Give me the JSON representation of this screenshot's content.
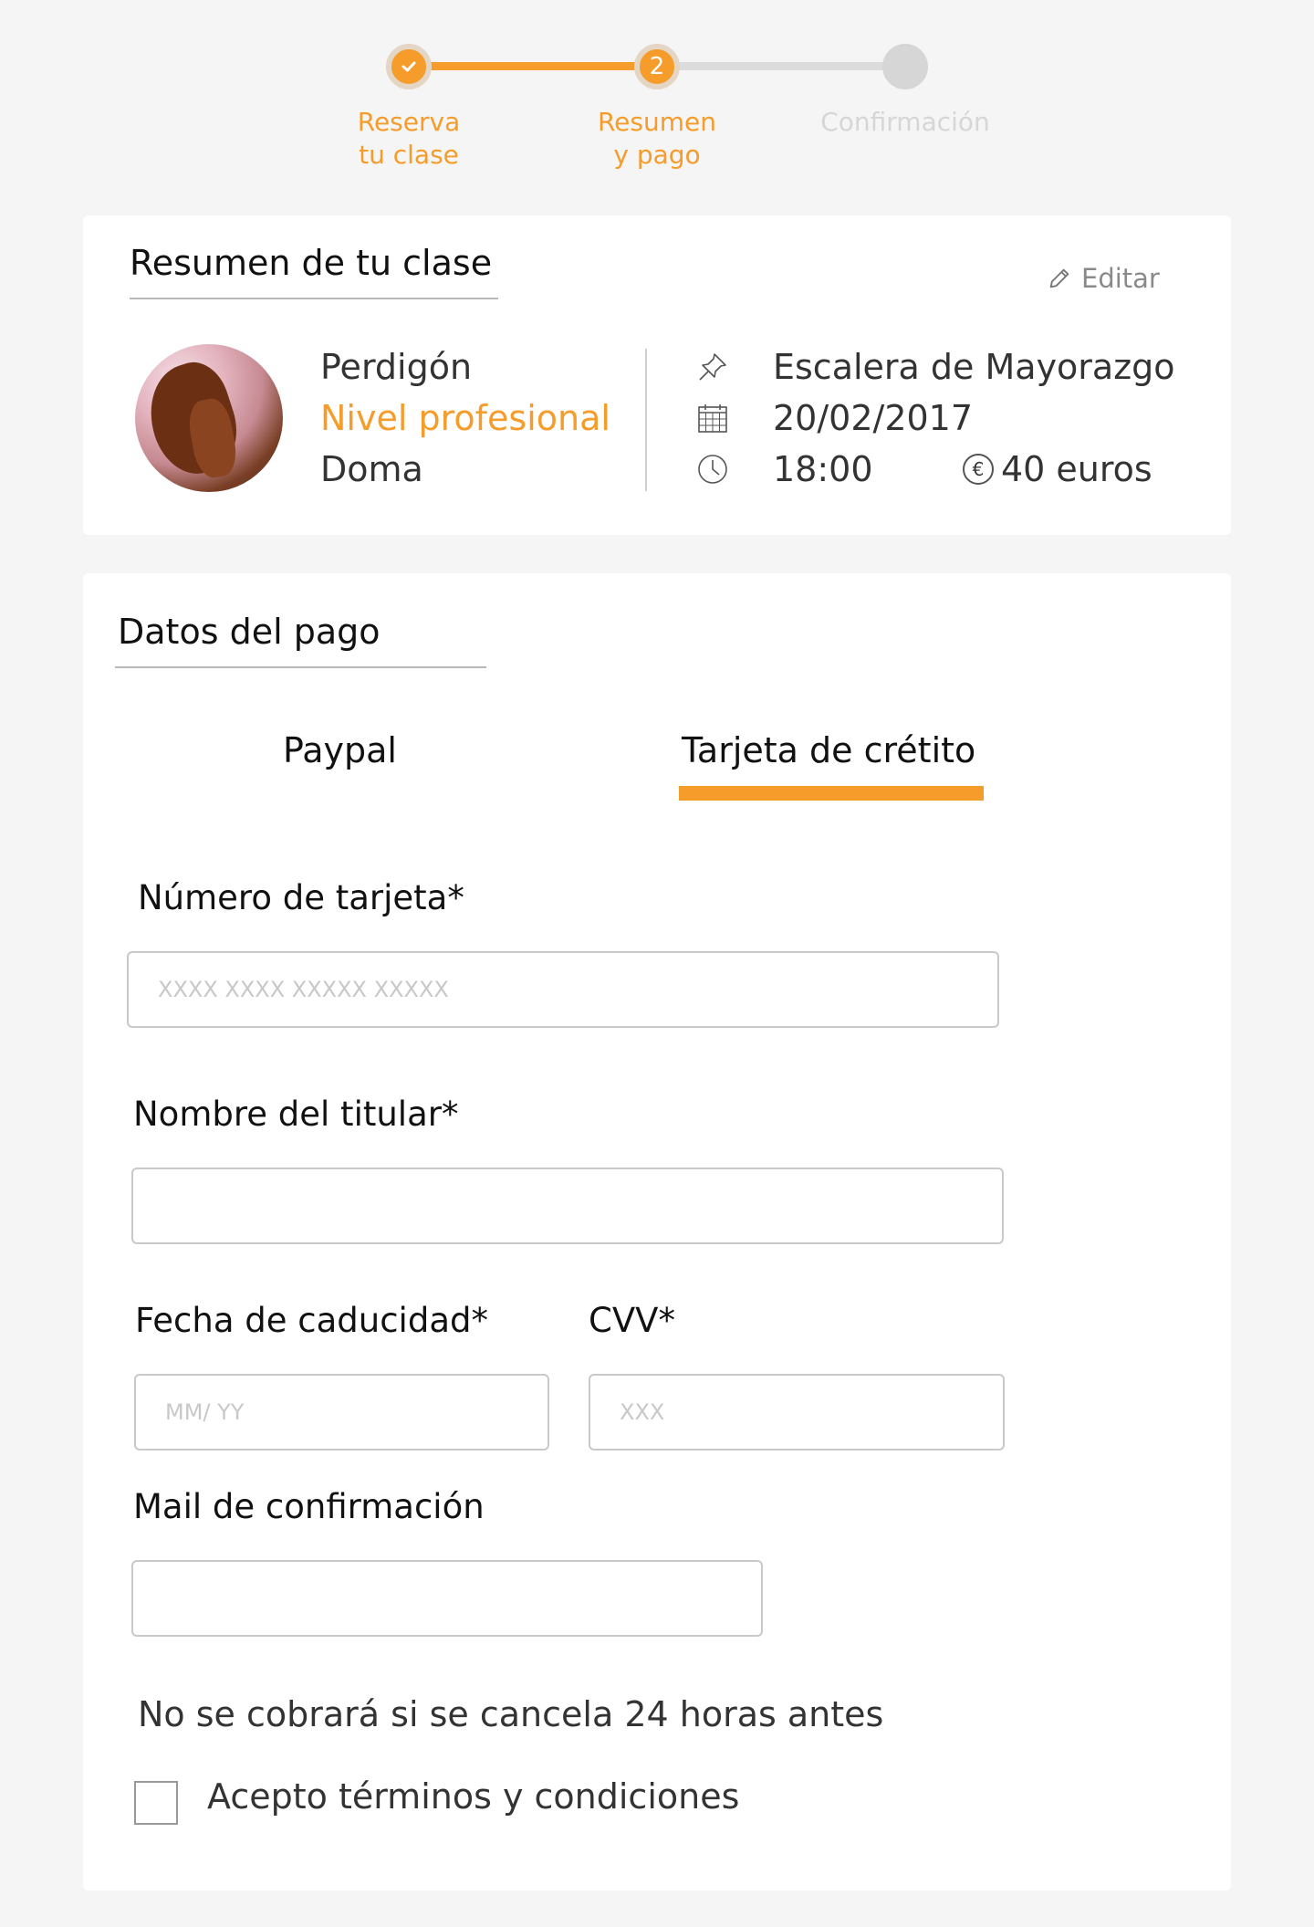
{
  "colors": {
    "accent": "#f59c2b",
    "inactive": "#d6d6d6",
    "background": "#f5f5f5"
  },
  "stepper": {
    "steps": [
      {
        "label": "Reserva\ntu clase",
        "state": "done",
        "icon": "check-icon"
      },
      {
        "label": "Resumen\ny pago",
        "state": "active",
        "number": "2"
      },
      {
        "label": "Confirmación",
        "state": "pending"
      }
    ]
  },
  "summary": {
    "title": "Resumen de tu clase",
    "edit_label": "Editar",
    "horse_name": "Perdigón",
    "level": "Nivel profesional",
    "discipline": "Doma",
    "location": "Escalera de Mayorazgo",
    "date": "20/02/2017",
    "time": "18:00",
    "price": "40 euros",
    "icons": [
      "pin-icon",
      "calendar-icon",
      "clock-icon",
      "euro-icon"
    ]
  },
  "payment": {
    "title": "Datos del pago",
    "tabs": [
      {
        "label": "Paypal",
        "selected": false
      },
      {
        "label": "Tarjeta de crétito",
        "selected": true
      }
    ],
    "card_number": {
      "label": "Número de tarjeta*",
      "placeholder": "XXXX XXXX XXXXX XXXXX",
      "value": ""
    },
    "holder_name": {
      "label": "Nombre del titular*",
      "placeholder": "",
      "value": ""
    },
    "expiry": {
      "label": "Fecha de caducidad*",
      "placeholder": "MM/ YY",
      "value": ""
    },
    "cvv": {
      "label": "CVV*",
      "placeholder": "XXX",
      "value": ""
    },
    "email": {
      "label": "Mail de confirmación",
      "placeholder": "",
      "value": ""
    },
    "note": "No se cobrará si se cancela 24 horas antes",
    "terms_label": "Acepto términos y condiciones",
    "terms_checked": false
  }
}
